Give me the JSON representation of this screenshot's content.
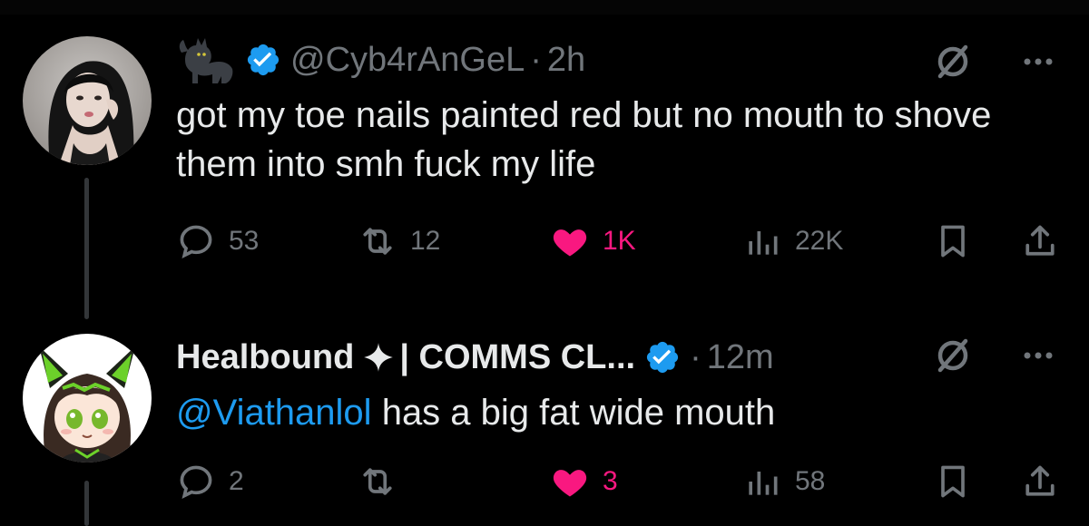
{
  "colors": {
    "background": "#000000",
    "text": "#e7e9ea",
    "muted": "#71767b",
    "accent": "#1d9bf0",
    "like": "#f91880",
    "thread_line": "#333639"
  },
  "tweets": [
    {
      "author_name_emoji": "black-cat-emoji",
      "verified": true,
      "handle": "@Cyb4rAnGeL",
      "separator": "·",
      "time": "2h",
      "text": "got my toe nails painted red but no mouth to shove them into smh fuck my life",
      "reply_count": "53",
      "repost_count": "12",
      "like_count": "1K",
      "liked": true,
      "views": "22K"
    },
    {
      "author_name": "Healbound",
      "author_name_suffix": "| COMMS CL...",
      "verified": true,
      "separator": "·",
      "time": "12m",
      "mention": "@Viathanlol",
      "text": " has a big fat wide mouth",
      "reply_count": "2",
      "repost_count": "",
      "like_count": "3",
      "liked": true,
      "views": "58"
    }
  ]
}
